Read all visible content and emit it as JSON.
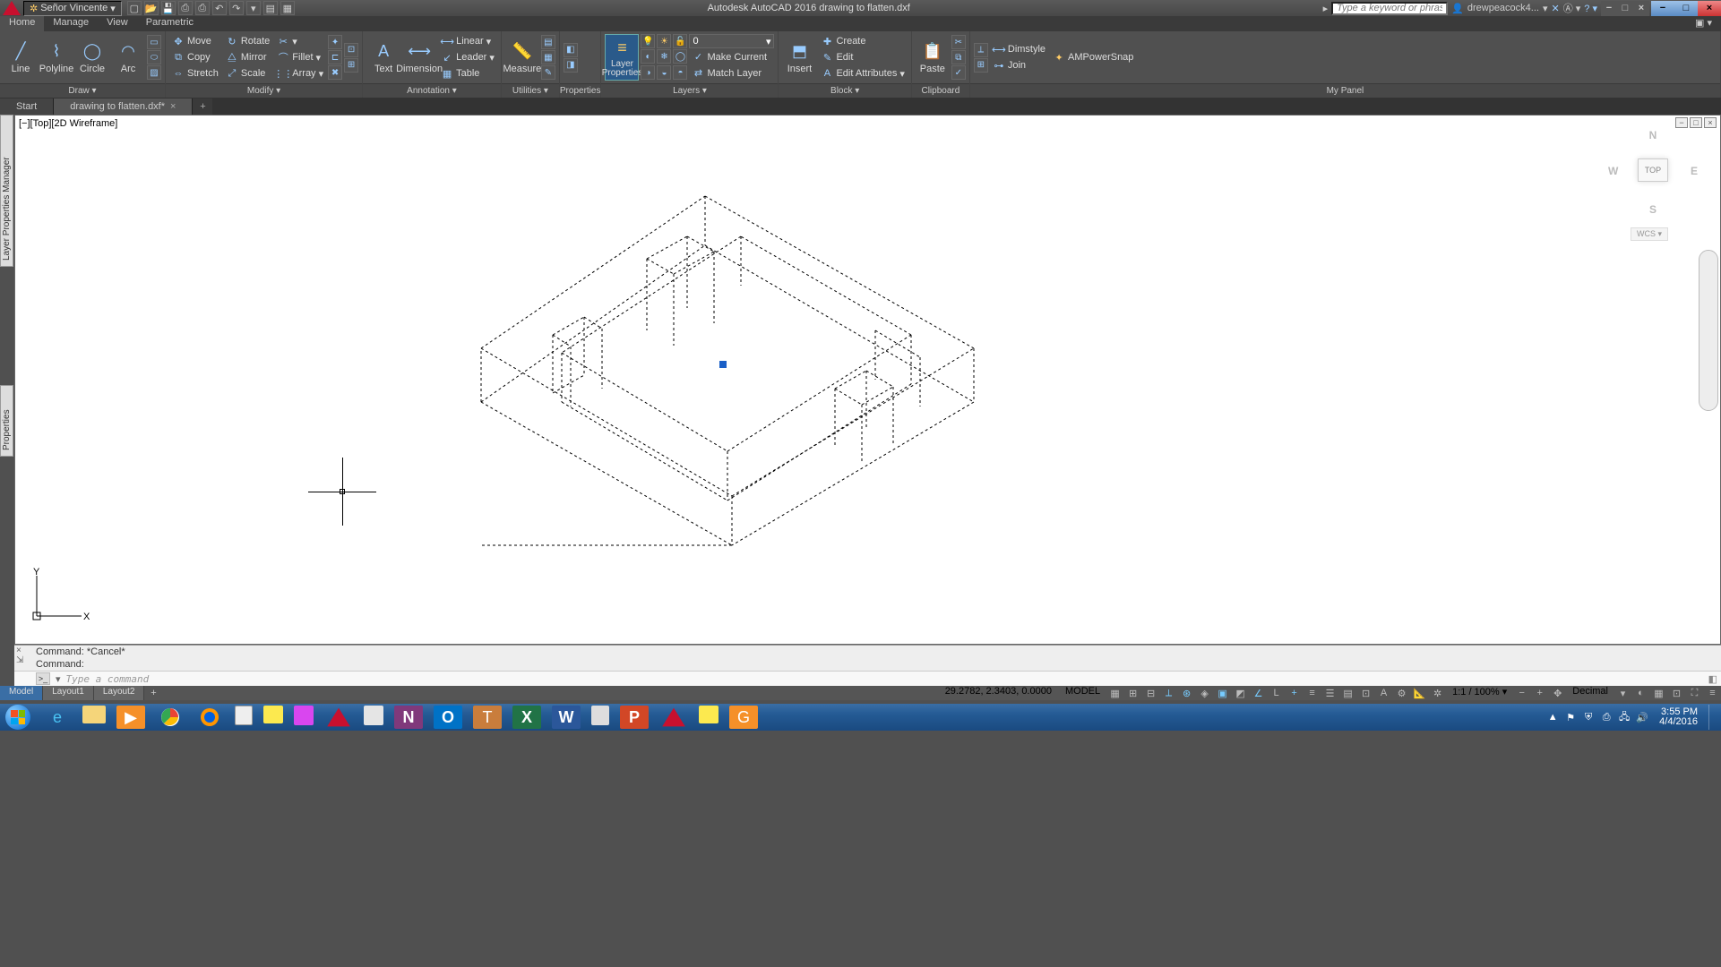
{
  "app": {
    "workspace": "Señor Vincente",
    "title": "Autodesk AutoCAD 2016    drawing to flatten.dxf",
    "search_placeholder": "Type a keyword or phrase",
    "user": "drewpeacock4..."
  },
  "menu": {
    "tabs": [
      "Home",
      "Manage",
      "View",
      "Parametric"
    ],
    "active": 0
  },
  "ribbon": {
    "draw": {
      "title": "Draw ▾",
      "line": "Line",
      "polyline": "Polyline",
      "circle": "Circle",
      "arc": "Arc"
    },
    "modify": {
      "title": "Modify ▾",
      "move": "Move",
      "rotate": "Rotate",
      "copy": "Copy",
      "mirror": "Mirror",
      "stretch": "Stretch",
      "scale": "Scale",
      "fillet": "Fillet",
      "array": "Array"
    },
    "annotation": {
      "title": "Annotation ▾",
      "text": "Text",
      "dimension": "Dimension",
      "linear": "Linear",
      "leader": "Leader",
      "table": "Table"
    },
    "utilities": {
      "title": "Utilities ▾",
      "measure": "Measure"
    },
    "layers": {
      "title": "Layers ▾",
      "properties": "Layer\nProperties",
      "current": "0",
      "make_current": "Make Current",
      "match": "Match Layer"
    },
    "block": {
      "title": "Block ▾",
      "insert": "Insert",
      "create": "Create",
      "edit": "Edit",
      "edit_attr": "Edit Attributes"
    },
    "clipboard": {
      "title": "Clipboard",
      "paste": "Paste"
    },
    "mypanel": {
      "title": "My Panel",
      "dimstyle": "Dimstyle",
      "ampowersnap": "AMPowerSnap",
      "join": "Join"
    }
  },
  "doctabs": {
    "start": "Start",
    "file": "drawing to flatten.dxf*"
  },
  "viewport": {
    "label_parts": [
      "[−]",
      "[Top]",
      "[2D Wireframe]"
    ],
    "viewcube": {
      "n": "N",
      "s": "S",
      "e": "E",
      "w": "W",
      "top": "TOP",
      "wcs": "WCS ▾"
    }
  },
  "palettes": [
    "Layer Properties Manager",
    "Properties"
  ],
  "ucs": {
    "x": "X",
    "y": "Y"
  },
  "command": {
    "hist1": "Command: *Cancel*",
    "hist2": "Command:",
    "placeholder": "Type a command"
  },
  "layouts": [
    "Model",
    "Layout1",
    "Layout2"
  ],
  "status": {
    "coords": "29.2782, 2.3403, 0.0000",
    "space": "MODEL",
    "scale": "1:1 / 100% ▾",
    "units": "Decimal"
  },
  "tray": {
    "time": "3:55 PM",
    "date": "4/4/2016"
  }
}
